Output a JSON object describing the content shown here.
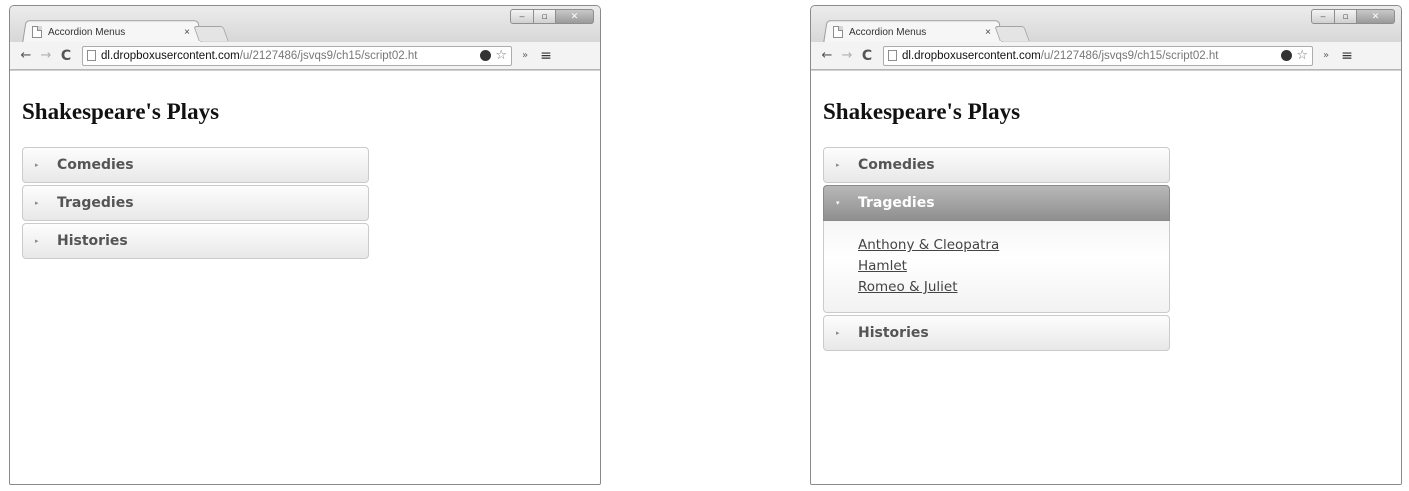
{
  "left_window": {
    "tab_title": "Accordion Menus",
    "tab_close": "×",
    "url_host": "dl.dropboxusercontent.com",
    "url_path": "/u/2127486/jsvqs9/ch15/script02.ht",
    "page_title": "Shakespeare's Plays",
    "sections": [
      {
        "label": "Comedies"
      },
      {
        "label": "Tragedies"
      },
      {
        "label": "Histories"
      }
    ]
  },
  "right_window": {
    "tab_title": "Accordion Menus",
    "tab_close": "×",
    "url_host": "dl.dropboxusercontent.com",
    "url_path": "/u/2127486/jsvqs9/ch15/script02.ht",
    "page_title": "Shakespeare's Plays",
    "sections": [
      {
        "label": "Comedies",
        "expanded": false
      },
      {
        "label": "Tragedies",
        "expanded": true,
        "links": [
          "Anthony & Cleopatra",
          "Hamlet",
          "Romeo & Juliet"
        ]
      },
      {
        "label": "Histories",
        "expanded": false
      }
    ]
  },
  "icons": {
    "back": "←",
    "forward": "→",
    "reload": "C",
    "star": "☆",
    "overflow": "»",
    "menu": "≡",
    "collapsed_arrow": "▸",
    "expanded_arrow": "▾",
    "minimize": "‒",
    "maximize": "▫",
    "close": "✕"
  }
}
